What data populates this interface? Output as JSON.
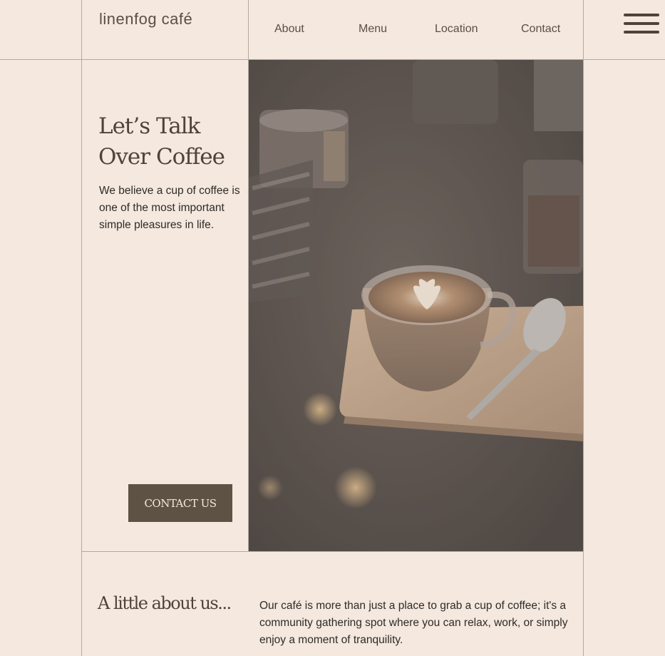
{
  "brand": {
    "name": "linenfog café"
  },
  "nav": {
    "items": [
      "About",
      "Menu",
      "Location",
      "Contact"
    ],
    "menu_icon": "hamburger-menu-icon"
  },
  "hero": {
    "title_line1": "Let’s Talk",
    "title_line2": "Over Coffee",
    "text": "We believe a cup of coffee is one of the most important simple pleasures in life.",
    "cta_label": "CONTACT US",
    "photo_subject": "latte-art-cup-on-wooden-board"
  },
  "about": {
    "title": "A little about us...",
    "text": "Our café is more than just a place to grab a cup of coffee; it's a community gathering spot where you can relax, work, or simply enjoy a moment of tranquility."
  },
  "colors": {
    "background": "#f4e8df",
    "accent": "#5e5244",
    "heading": "#4f4339",
    "divider": "#b3aaa2"
  }
}
